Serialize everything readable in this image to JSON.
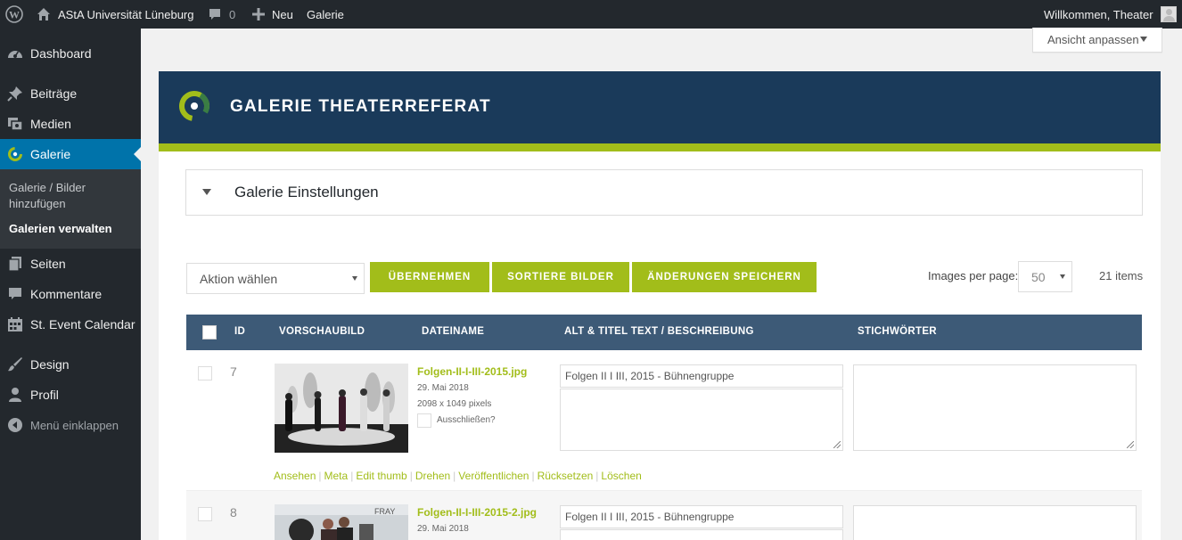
{
  "adminbar": {
    "site_name": "AStA Universität Lüneburg",
    "comments_count": "0",
    "new_label": "Neu",
    "gallery_label": "Galerie",
    "greeting": "Willkommen, Theater"
  },
  "sidebar": {
    "items": [
      {
        "label": "Dashboard",
        "icon": "dashboard-icon"
      },
      {
        "label": "Beiträge",
        "icon": "pin-icon"
      },
      {
        "label": "Medien",
        "icon": "media-icon"
      },
      {
        "label": "Galerie",
        "icon": "nextgen-icon"
      },
      {
        "label": "Seiten",
        "icon": "pages-icon"
      },
      {
        "label": "Kommentare",
        "icon": "comment-icon"
      },
      {
        "label": "St. Event Calendar",
        "icon": "calendar-icon"
      },
      {
        "label": "Design",
        "icon": "brush-icon"
      },
      {
        "label": "Profil",
        "icon": "user-icon"
      },
      {
        "label": "Menü einklappen",
        "icon": "collapse-icon"
      }
    ],
    "submenu": [
      {
        "label": "Galerie / Bilder hinzufügen"
      },
      {
        "label": "Galerien verwalten"
      }
    ]
  },
  "screen_options": "Ansicht anpassen",
  "banner": {
    "title": "GALERIE THEATERREFERAT"
  },
  "settings": {
    "title": "Galerie Einstellungen"
  },
  "toolbar": {
    "action_select": "Aktion wählen",
    "apply": "ÜBERNEHMEN",
    "sort": "SORTIERE BILDER",
    "save": "ÄNDERUNGEN SPEICHERN",
    "ipp_label": "Images per page:",
    "ipp_value": "50",
    "items_count": "21 items"
  },
  "table": {
    "headers": {
      "id": "ID",
      "preview": "VORSCHAUBILD",
      "filename": "DATEINAME",
      "alt": "ALT & TITEL TEXT / BESCHREIBUNG",
      "tags": "STICHWÖRTER"
    },
    "rows": [
      {
        "id": "7",
        "filename": "Folgen-II-I-III-2015.jpg",
        "date": "29. Mai 2018",
        "dimensions": "2098 x 1049 pixels",
        "exclude_label": "Ausschließen?",
        "alt_text": "Folgen II I III, 2015 - Bühnengruppe"
      },
      {
        "id": "8",
        "filename": "Folgen-II-I-III-2015-2.jpg",
        "date": "29. Mai 2018",
        "alt_text": "Folgen II I III, 2015 - Bühnengruppe"
      }
    ],
    "row_actions": [
      "Ansehen",
      "Meta",
      "Edit thumb",
      "Drehen",
      "Veröffentlichen",
      "Rücksetzen",
      "Löschen"
    ]
  }
}
